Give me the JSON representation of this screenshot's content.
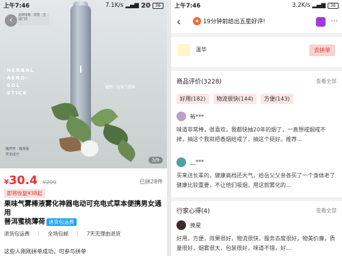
{
  "left": {
    "status": {
      "time": "上午7:46",
      "net": "7.1K/s",
      "battery": "36"
    },
    "top_thumb_text": "品牌指数 · 反馈 · 全国门店",
    "watermark": "20",
    "hero": {
      "herbal_lines": [
        "HERBAL",
        "AERO-",
        "SOL",
        "STICK"
      ],
      "plant_note": "植物 · 百草气雾棒",
      "brand_line": "嘴芳芳 · 植萃系",
      "brand_sub": "草本成分",
      "counter": "3/9"
    },
    "price": {
      "yen": "¥",
      "value": "30.4",
      "original": "¥299",
      "sold": "已拼28件"
    },
    "promo": "即将恢复¥38起",
    "title_line1": "果味气雾棒液雾化神器电动可充电式草本便携男女通用",
    "title_line2": "普洱蜜桃薄荷",
    "title_pill": "退货包运费",
    "services": [
      "退货包运费",
      "全场包邮",
      "7天无理由退货"
    ],
    "bottom_cut": "这些人刚刚拼单成功，可参与拼单"
  },
  "right": {
    "status": {
      "time": "上午7:46",
      "net": "3.2K/s",
      "battery": "36"
    },
    "banner_text": "19分钟前给出五星好评!",
    "store_name": "温华",
    "store_button": "去拼单",
    "reviews_title": "商品评价(3228)",
    "see_all": "查看全部",
    "tags": [
      "好用(182)",
      "物流很快(144)",
      "方便(143)"
    ],
    "review1": {
      "user": "裕***",
      "text": "味道非常棒，很喜欢，我都快抽20年的烟了，一直想戒烟戒不掉，抽这个我就把香烟给戒了，抽这个挺好。推荐…"
    },
    "review2": {
      "user": "__***",
      "text": "买来送长辈的，健康高档还大气，给岳父父亲各买了一个身体老了健康比较重要，不让他们吸烟，用这款雾化的…"
    },
    "pros_title": "行家心得(4)",
    "pro_review": {
      "user": "挽星",
      "text": "好用，方便，效果很好，物流很快，服务态度很好，物美价廉，质量很好，烟雾很大，包装很好，味道不错，好…"
    }
  }
}
